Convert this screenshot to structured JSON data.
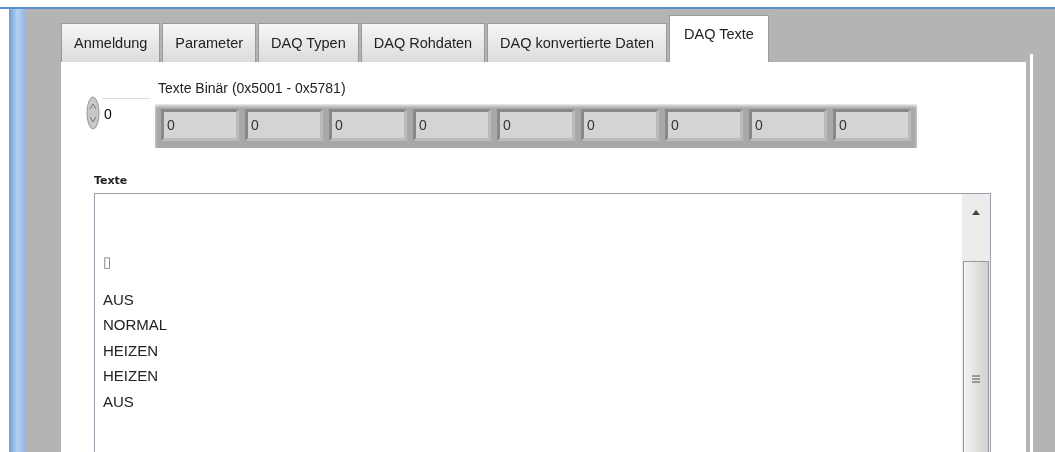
{
  "tabs": [
    {
      "label": "Anmeldung",
      "selected": false
    },
    {
      "label": "Parameter",
      "selected": false
    },
    {
      "label": "DAQ Typen",
      "selected": false
    },
    {
      "label": "DAQ Rohdaten",
      "selected": false
    },
    {
      "label": "DAQ konvertierte Daten",
      "selected": false
    },
    {
      "label": "DAQ Texte",
      "selected": true
    }
  ],
  "binary_array": {
    "label": "Texte Binär (0x5001 - 0x5781)",
    "index": "0",
    "values": [
      "0",
      "0",
      "0",
      "0",
      "0",
      "0",
      "0",
      "0",
      "0"
    ]
  },
  "texts": {
    "label": "Texte",
    "lines": [
      "▯",
      "AUS",
      "NORMAL",
      "HEIZEN",
      "HEIZEN",
      "AUS"
    ]
  }
}
